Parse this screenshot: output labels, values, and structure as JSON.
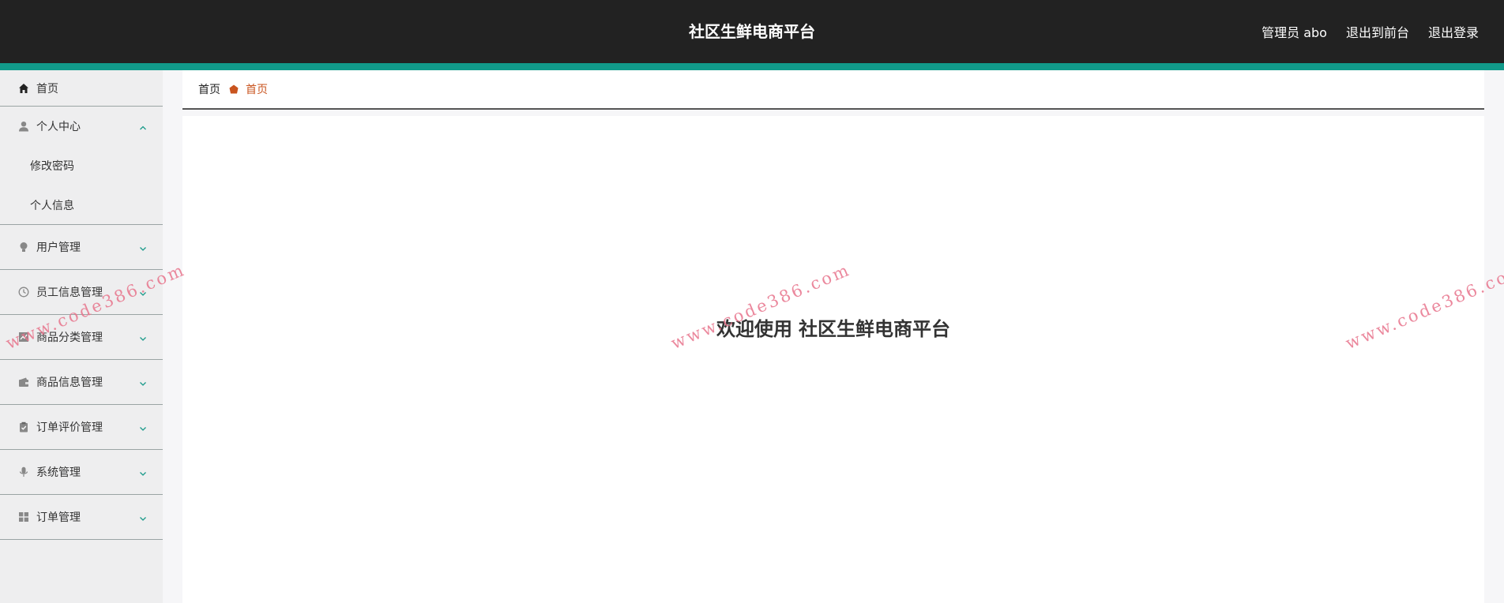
{
  "header": {
    "title": "社区生鲜电商平台",
    "user_label": "管理员 abo",
    "exit_front_label": "退出到前台",
    "logout_label": "退出登录",
    "bg_color": "#222222",
    "accent_color": "#119a8a"
  },
  "sidebar": {
    "home": {
      "label": "首页",
      "icon": "home-icon"
    },
    "personal": {
      "label": "个人中心",
      "icon": "user-icon",
      "expanded": true,
      "children": [
        {
          "label": "修改密码"
        },
        {
          "label": "个人信息"
        }
      ]
    },
    "groups": [
      {
        "label": "用户管理",
        "icon": "bulb-icon"
      },
      {
        "label": "员工信息管理",
        "icon": "clock-icon"
      },
      {
        "label": "商品分类管理",
        "icon": "chart-icon"
      },
      {
        "label": "商品信息管理",
        "icon": "wallet-icon"
      },
      {
        "label": "订单评价管理",
        "icon": "clipboard-icon"
      },
      {
        "label": "系统管理",
        "icon": "microphone-icon"
      },
      {
        "label": "订单管理",
        "icon": "grid-icon"
      }
    ]
  },
  "breadcrumb": {
    "home_label": "首页",
    "current_label": "首页",
    "current_color": "#c9541f"
  },
  "main": {
    "welcome_prefix": "欢迎使用",
    "welcome_name": "社区生鲜电商平台"
  },
  "watermarks": [
    {
      "text": "www.code386.com"
    },
    {
      "text": "www.code386.com"
    },
    {
      "text": "www.code386.com"
    }
  ]
}
